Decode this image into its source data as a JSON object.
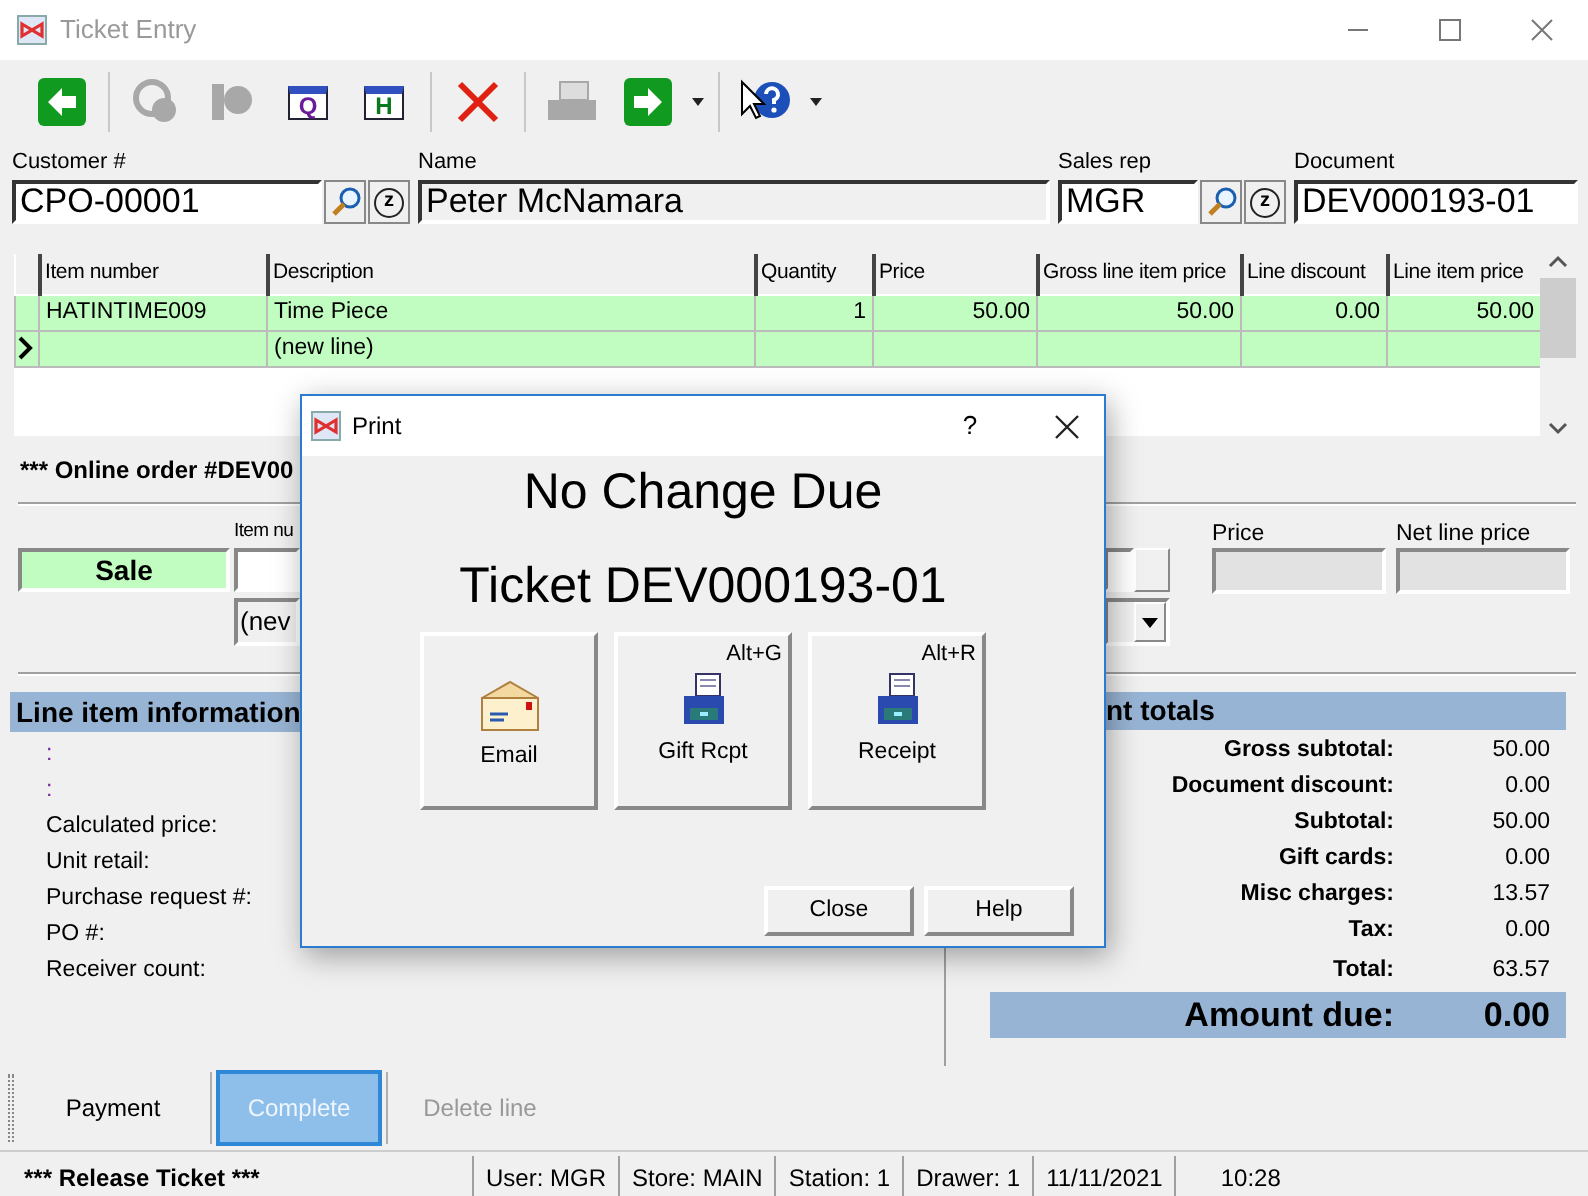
{
  "window": {
    "title": "Ticket Entry"
  },
  "toolbar": [
    {
      "kind": "back",
      "disabled": false
    },
    {
      "kind": "separator"
    },
    {
      "kind": "gear-search",
      "disabled": true
    },
    {
      "kind": "gear-page",
      "disabled": true
    },
    {
      "kind": "window",
      "label": "Q",
      "disabled": false
    },
    {
      "kind": "window",
      "label": "H",
      "disabled": false
    },
    {
      "kind": "separator"
    },
    {
      "kind": "delete",
      "disabled": false
    },
    {
      "kind": "separator"
    },
    {
      "kind": "print",
      "disabled": true
    },
    {
      "kind": "forward",
      "disabled": false,
      "dropdown": true
    },
    {
      "kind": "separator"
    },
    {
      "kind": "help",
      "disabled": false,
      "dropdown": true
    }
  ],
  "header_fields": [
    {
      "label": "Customer #",
      "value": "CPO-00001",
      "readonly": false,
      "kind": "lookup",
      "clear_label": "z"
    },
    {
      "label": "Name",
      "value": "Peter McNamara",
      "readonly": true,
      "kind": "plain"
    },
    {
      "label": "Sales rep",
      "value": "MGR",
      "readonly": false,
      "kind": "lookup",
      "clear_label": "z"
    },
    {
      "label": "Document",
      "value": "DEV000193-01",
      "readonly": false,
      "kind": "plain"
    }
  ],
  "grid": {
    "columns": [
      "Item number",
      "Description",
      "Quantity",
      "Price",
      "Gross line item price",
      "Line discount",
      "Line item price"
    ],
    "rows": [
      {
        "current": false,
        "cells": [
          "HATINTIME009",
          "Time Piece",
          "1",
          "50.00",
          "50.00",
          "0.00",
          "50.00"
        ]
      },
      {
        "current": true,
        "cells": [
          "",
          "(new line)",
          "",
          "",
          "",
          "",
          ""
        ]
      }
    ]
  },
  "order_note": "*** Online order #DEV00",
  "entry": {
    "mode": "Sale",
    "item_label": "Item nu",
    "item_choice": "(nev",
    "price_label": "Price",
    "net_label": "Net line price"
  },
  "line_info": {
    "title": "Line item information",
    "rows": [
      {
        "kind": "blank",
        "label": ":"
      },
      {
        "kind": "blank",
        "label": ":"
      },
      {
        "kind": "field",
        "label": "Calculated price:"
      },
      {
        "kind": "field",
        "label": "Unit retail:"
      },
      {
        "kind": "field",
        "label": "Purchase request #:"
      },
      {
        "kind": "field",
        "label": "PO #:"
      },
      {
        "kind": "field",
        "label": "Receiver count:"
      }
    ]
  },
  "totals": {
    "title": "nt totals",
    "rows": [
      {
        "label": "Gross subtotal:",
        "value": "50.00"
      },
      {
        "label": "Document discount:",
        "value": "0.00"
      },
      {
        "label": "Subtotal:",
        "value": "50.00"
      },
      {
        "label": "Gift cards:",
        "value": "0.00"
      },
      {
        "label": "Misc charges:",
        "value": "13.57"
      },
      {
        "label": "Tax:",
        "value": "0.00"
      },
      {
        "label": "Total:",
        "value": "63.57"
      }
    ],
    "amount_due": {
      "label": "Amount due:",
      "value": "0.00"
    }
  },
  "actions": [
    {
      "label": "Payment",
      "selected": false,
      "disabled": false
    },
    {
      "label": "Complete",
      "selected": true,
      "disabled": false
    },
    {
      "label": "Delete line",
      "selected": false,
      "disabled": true
    }
  ],
  "status_bar": [
    {
      "kind": "message",
      "text": "*** Release Ticket ***"
    },
    {
      "kind": "field",
      "text": "User: MGR"
    },
    {
      "kind": "field",
      "text": "Store: MAIN"
    },
    {
      "kind": "field",
      "text": "Station: 1"
    },
    {
      "kind": "field",
      "text": "Drawer: 1"
    },
    {
      "kind": "field",
      "text": "11/11/2021"
    },
    {
      "kind": "plain",
      "text": "10:28"
    }
  ],
  "dialog": {
    "title": "Print",
    "help": "?",
    "heading": "No Change Due",
    "subheading": "Ticket DEV000193-01",
    "buttons": [
      {
        "kind": "email",
        "label": "Email"
      },
      {
        "kind": "printer",
        "label": "Gift Rcpt",
        "shortcut": "Alt+G"
      },
      {
        "kind": "printer",
        "label": "Receipt",
        "shortcut": "Alt+R"
      }
    ],
    "footer_buttons": [
      "Close",
      "Help"
    ]
  }
}
